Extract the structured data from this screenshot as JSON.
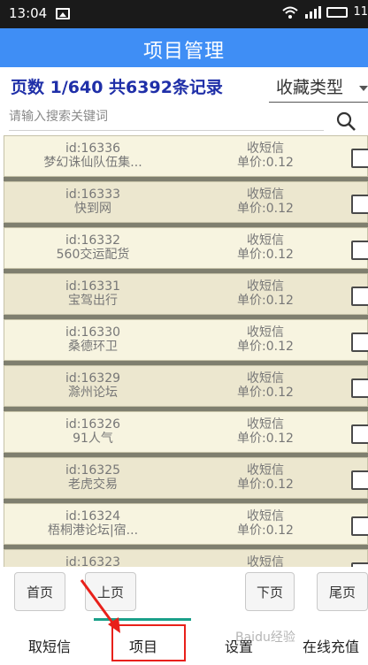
{
  "status_bar": {
    "time": "13:04",
    "icons": [
      "image-icon",
      "wifi-icon",
      "signal-icon",
      "battery-icon"
    ],
    "battery_text": "11"
  },
  "header": {
    "title": "项目管理"
  },
  "page_info": "页数 1/640 共6392条记录",
  "favorite_select": {
    "value": "收藏类型"
  },
  "search": {
    "placeholder": "请输入搜索关键词",
    "value": ""
  },
  "rows": [
    {
      "id": "id:16336",
      "name": "梦幻诛仙队伍集...",
      "type": "收短信",
      "price": "单价:0.12"
    },
    {
      "id": "id:16333",
      "name": "快到网",
      "type": "收短信",
      "price": "单价:0.12"
    },
    {
      "id": "id:16332",
      "name": "560交运配货",
      "type": "收短信",
      "price": "单价:0.12"
    },
    {
      "id": "id:16331",
      "name": "宝驾出行",
      "type": "收短信",
      "price": "单价:0.12"
    },
    {
      "id": "id:16330",
      "name": "桑德环卫",
      "type": "收短信",
      "price": "单价:0.12"
    },
    {
      "id": "id:16329",
      "name": "滁州论坛",
      "type": "收短信",
      "price": "单价:0.12"
    },
    {
      "id": "id:16326",
      "name": "91人气",
      "type": "收短信",
      "price": "单价:0.12"
    },
    {
      "id": "id:16325",
      "name": "老虎交易",
      "type": "收短信",
      "price": "单价:0.12"
    },
    {
      "id": "id:16324",
      "name": "梧桐港论坛|宿...",
      "type": "收短信",
      "price": "单价:0.12"
    },
    {
      "id": "id:16323",
      "name": "",
      "type": "收短信",
      "price": ""
    }
  ],
  "pager": {
    "first": "首页",
    "prev": "上页",
    "next": "下页",
    "last": "尾页"
  },
  "tabs": [
    "取短信",
    "项目",
    "设置",
    "在线充值"
  ],
  "watermark": "Baidu经验",
  "colors": {
    "header": "#3f8ef5",
    "page_info": "#1f2fa8",
    "active_tab": "#1aa089",
    "annotation": "#e8201a"
  }
}
